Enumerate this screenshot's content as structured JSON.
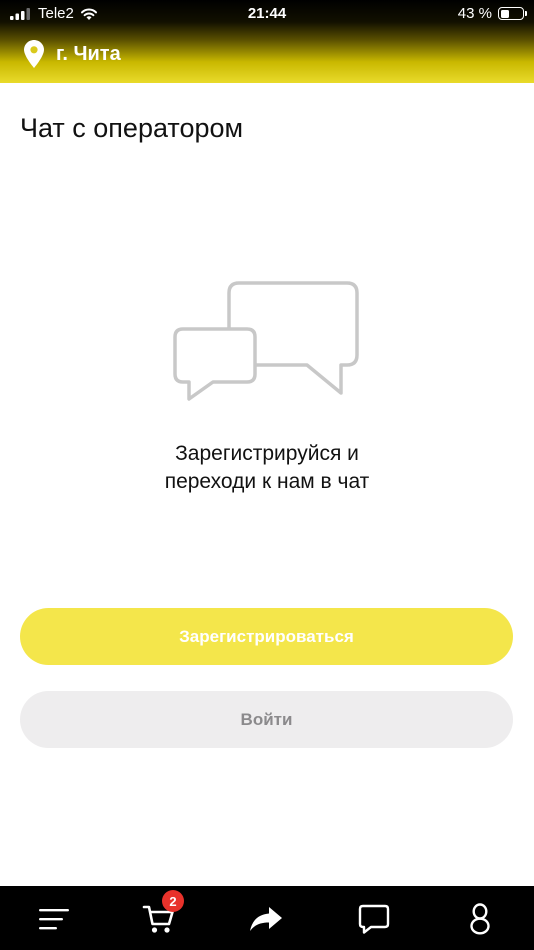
{
  "status_bar": {
    "carrier": "Tele2",
    "time": "21:44",
    "battery_percent": "43 %",
    "battery_level": 0.43
  },
  "header": {
    "city": "г. Чита"
  },
  "page": {
    "title": "Чат с оператором",
    "prompt_line1": "Зарегистрируйся и",
    "prompt_line2": "переходи к нам в чат"
  },
  "buttons": {
    "register_label": "Зарегистрироваться",
    "login_label": "Войти"
  },
  "tabbar": {
    "cart_badge": "2",
    "icons": [
      "menu-icon",
      "cart-icon",
      "share-icon",
      "chat-icon",
      "profile-icon"
    ]
  },
  "colors": {
    "accent_yellow": "#f4e64b",
    "login_bg": "#eeedee",
    "badge_red": "#e8322b"
  }
}
